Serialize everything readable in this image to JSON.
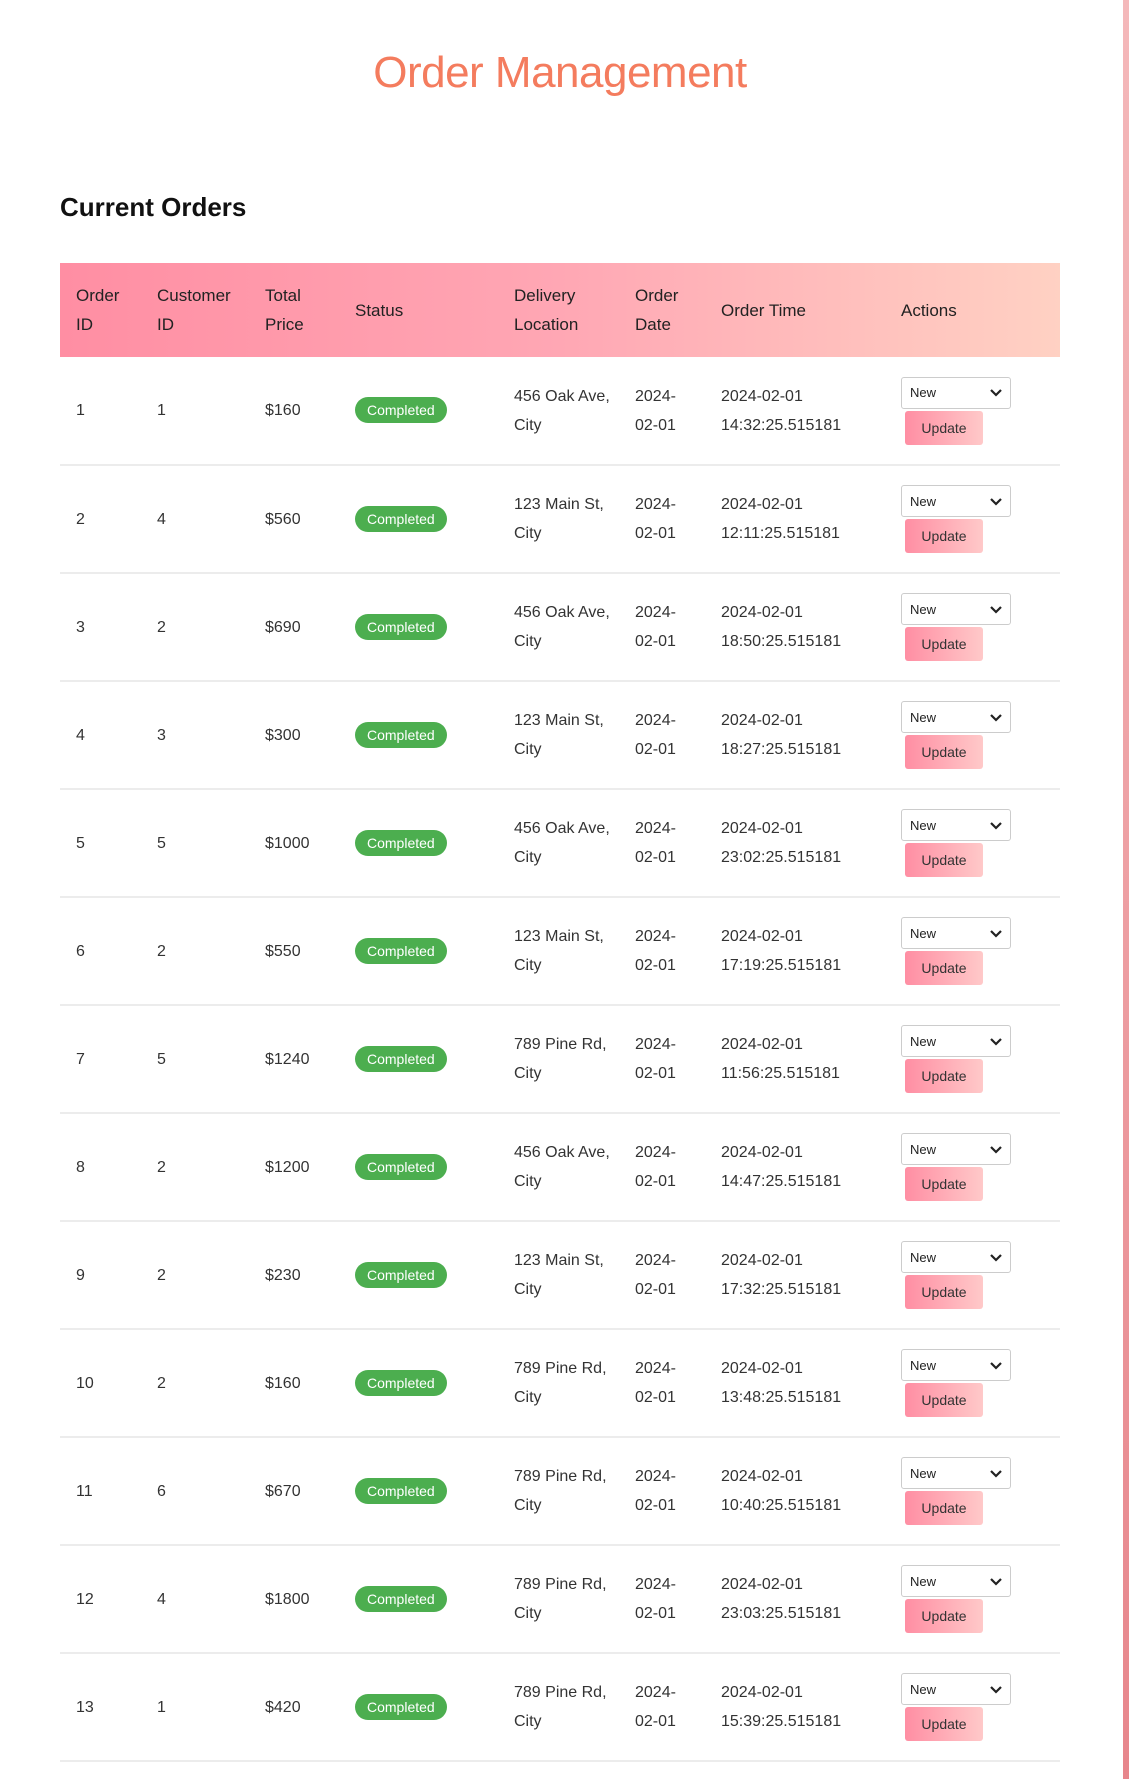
{
  "page": {
    "title": "Order Management",
    "section_title": "Current Orders"
  },
  "table": {
    "headers": [
      "Order ID",
      "Customer ID",
      "Total Price",
      "Status",
      "Delivery Location",
      "Order Date",
      "Order Time",
      "Actions"
    ],
    "rows": [
      {
        "order_id": "1",
        "customer_id": "1",
        "total_price": "$160",
        "status": "Completed",
        "location": "456 Oak Ave, City",
        "date": "2024-02-01",
        "time": "2024-02-01 14:32:25.515181"
      },
      {
        "order_id": "2",
        "customer_id": "4",
        "total_price": "$560",
        "status": "Completed",
        "location": "123 Main St, City",
        "date": "2024-02-01",
        "time": "2024-02-01 12:11:25.515181"
      },
      {
        "order_id": "3",
        "customer_id": "2",
        "total_price": "$690",
        "status": "Completed",
        "location": "456 Oak Ave, City",
        "date": "2024-02-01",
        "time": "2024-02-01 18:50:25.515181"
      },
      {
        "order_id": "4",
        "customer_id": "3",
        "total_price": "$300",
        "status": "Completed",
        "location": "123 Main St, City",
        "date": "2024-02-01",
        "time": "2024-02-01 18:27:25.515181"
      },
      {
        "order_id": "5",
        "customer_id": "5",
        "total_price": "$1000",
        "status": "Completed",
        "location": "456 Oak Ave, City",
        "date": "2024-02-01",
        "time": "2024-02-01 23:02:25.515181"
      },
      {
        "order_id": "6",
        "customer_id": "2",
        "total_price": "$550",
        "status": "Completed",
        "location": "123 Main St, City",
        "date": "2024-02-01",
        "time": "2024-02-01 17:19:25.515181"
      },
      {
        "order_id": "7",
        "customer_id": "5",
        "total_price": "$1240",
        "status": "Completed",
        "location": "789 Pine Rd, City",
        "date": "2024-02-01",
        "time": "2024-02-01 11:56:25.515181"
      },
      {
        "order_id": "8",
        "customer_id": "2",
        "total_price": "$1200",
        "status": "Completed",
        "location": "456 Oak Ave, City",
        "date": "2024-02-01",
        "time": "2024-02-01 14:47:25.515181"
      },
      {
        "order_id": "9",
        "customer_id": "2",
        "total_price": "$230",
        "status": "Completed",
        "location": "123 Main St, City",
        "date": "2024-02-01",
        "time": "2024-02-01 17:32:25.515181"
      },
      {
        "order_id": "10",
        "customer_id": "2",
        "total_price": "$160",
        "status": "Completed",
        "location": "789 Pine Rd, City",
        "date": "2024-02-01",
        "time": "2024-02-01 13:48:25.515181"
      },
      {
        "order_id": "11",
        "customer_id": "6",
        "total_price": "$670",
        "status": "Completed",
        "location": "789 Pine Rd, City",
        "date": "2024-02-01",
        "time": "2024-02-01 10:40:25.515181"
      },
      {
        "order_id": "12",
        "customer_id": "4",
        "total_price": "$1800",
        "status": "Completed",
        "location": "789 Pine Rd, City",
        "date": "2024-02-01",
        "time": "2024-02-01 23:03:25.515181"
      },
      {
        "order_id": "13",
        "customer_id": "1",
        "total_price": "$420",
        "status": "Completed",
        "location": "789 Pine Rd, City",
        "date": "2024-02-01",
        "time": "2024-02-01 15:39:25.515181"
      }
    ]
  },
  "actions": {
    "select_value": "New",
    "update_label": "Update"
  },
  "icons": {
    "select_chevron": "chevron-down-icon"
  },
  "colors": {
    "title": "#f47c5e",
    "header_gradient_start": "#ff8ea3",
    "header_gradient_end": "#ffd1c3",
    "badge": "#4cae4f",
    "update_button_start": "#ff8ea3",
    "update_button_end": "#ffc9c9",
    "right_border": "#e7868c"
  }
}
